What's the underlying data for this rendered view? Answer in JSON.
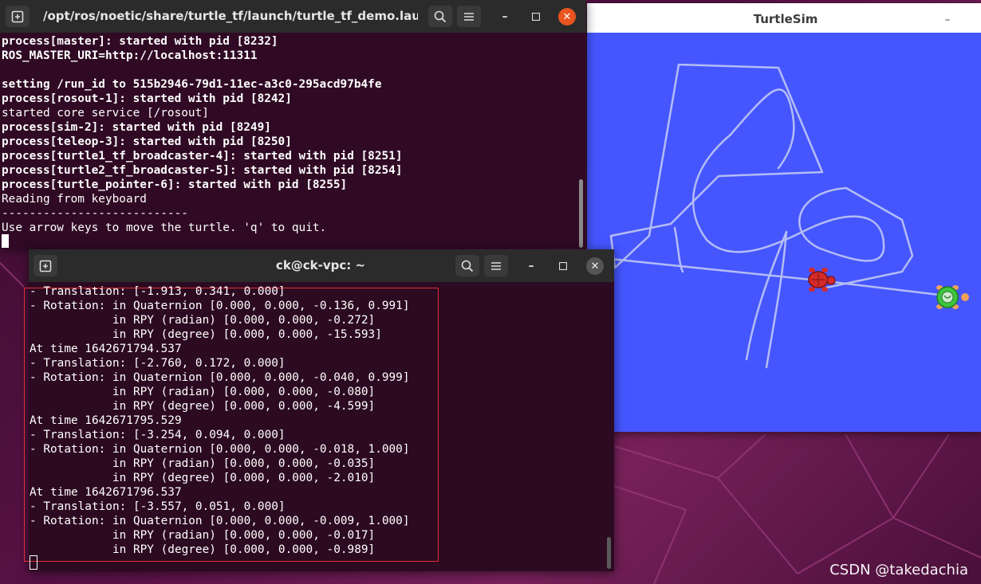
{
  "terminal1": {
    "title": "/opt/ros/noetic/share/turtle_tf/launch/turtle_tf_demo.launch ...",
    "lines": [
      {
        "t": "process[master]: started with pid [8232]",
        "bold": true
      },
      {
        "t": "ROS_MASTER_URI=http://localhost:11311",
        "bold": true
      },
      {
        "t": "",
        "bold": false
      },
      {
        "t": "setting /run_id to 515b2946-79d1-11ec-a3c0-295acd97b4fe",
        "bold": true
      },
      {
        "t": "process[rosout-1]: started with pid [8242]",
        "bold": true
      },
      {
        "t": "started core service [/rosout]",
        "bold": false
      },
      {
        "t": "process[sim-2]: started with pid [8249]",
        "bold": true
      },
      {
        "t": "process[teleop-3]: started with pid [8250]",
        "bold": true
      },
      {
        "t": "process[turtle1_tf_broadcaster-4]: started with pid [8251]",
        "bold": true
      },
      {
        "t": "process[turtle2_tf_broadcaster-5]: started with pid [8254]",
        "bold": true
      },
      {
        "t": "process[turtle_pointer-6]: started with pid [8255]",
        "bold": true
      },
      {
        "t": "Reading from keyboard",
        "bold": false
      },
      {
        "t": "---------------------------",
        "bold": false
      },
      {
        "t": "Use arrow keys to move the turtle. 'q' to quit.",
        "bold": false
      }
    ]
  },
  "terminal2": {
    "title": "ck@ck-vpc: ~",
    "lines": [
      "- Translation: [-1.913, 0.341, 0.000]",
      "- Rotation: in Quaternion [0.000, 0.000, -0.136, 0.991]",
      "            in RPY (radian) [0.000, 0.000, -0.272]",
      "            in RPY (degree) [0.000, 0.000, -15.593]",
      "At time 1642671794.537",
      "- Translation: [-2.760, 0.172, 0.000]",
      "- Rotation: in Quaternion [0.000, 0.000, -0.040, 0.999]",
      "            in RPY (radian) [0.000, 0.000, -0.080]",
      "            in RPY (degree) [0.000, 0.000, -4.599]",
      "At time 1642671795.529",
      "- Translation: [-3.254, 0.094, 0.000]",
      "- Rotation: in Quaternion [0.000, 0.000, -0.018, 1.000]",
      "            in RPY (radian) [0.000, 0.000, -0.035]",
      "            in RPY (degree) [0.000, 0.000, -2.010]",
      "At time 1642671796.537",
      "- Translation: [-3.557, 0.051, 0.000]",
      "- Rotation: in Quaternion [0.000, 0.000, -0.009, 1.000]",
      "            in RPY (radian) [0.000, 0.000, -0.017]",
      "            in RPY (degree) [0.000, 0.000, -0.989]"
    ]
  },
  "turtlesim": {
    "title": "TurtleSim",
    "background": "#4556ff",
    "path_color": "#b3bcf5"
  },
  "watermark": "CSDN @takedachia",
  "icons": {
    "new_tab": "new-tab-icon",
    "search": "search-icon",
    "menu": "hamburger-menu-icon",
    "minimize": "minimize-icon",
    "maximize": "maximize-icon",
    "close": "close-icon"
  }
}
